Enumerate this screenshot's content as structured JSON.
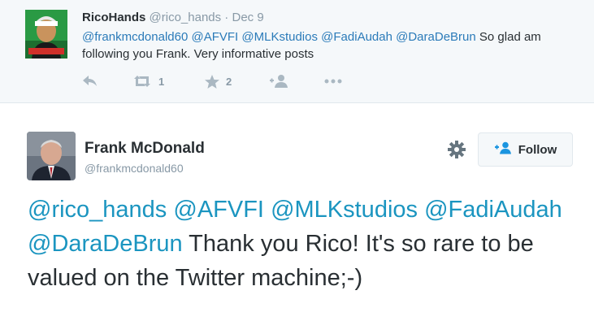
{
  "reply_tweet": {
    "display_name": "RicoHands",
    "handle": "@rico_hands",
    "separator": " · ",
    "date": "Dec 9",
    "mentions": [
      "@frankmcdonald60",
      "@AFVFI",
      "@MLKstudios",
      "@FadiAudah",
      "@DaraDeBrun"
    ],
    "text": "So glad am following you Frank. Very informative posts",
    "retweet_count": "1",
    "favorite_count": "2",
    "icons": [
      "reply-icon",
      "retweet-icon",
      "favorite-icon",
      "follow-icon",
      "more-icon"
    ]
  },
  "main_tweet": {
    "display_name": "Frank McDonald",
    "handle": "@frankmcdonald60",
    "follow_label": "Follow",
    "mentions": [
      "@rico_hands",
      "@AFVFI",
      "@MLKstudios",
      "@FadiAudah",
      "@DaraDeBrun"
    ],
    "text": "Thank you Rico! It's so rare to be valued on the Twitter machine;-)"
  },
  "colors": {
    "link": "#2b7bb9",
    "big_link": "#1b95c0",
    "muted": "#8899a6",
    "text": "#292f33",
    "reply_bg": "#f5f8fa"
  }
}
